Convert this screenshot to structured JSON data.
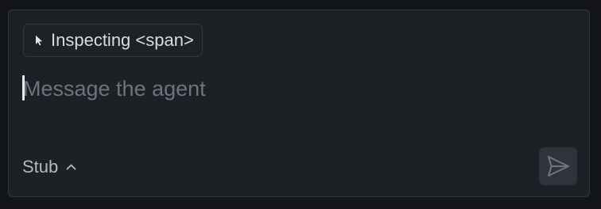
{
  "composer": {
    "context_chip": {
      "label": "Inspecting <span>",
      "icon": "cursor-pointer-icon"
    },
    "input": {
      "value": "",
      "placeholder": "Message the agent"
    },
    "model_selector": {
      "label": "Stub",
      "icon": "chevron-up-icon"
    },
    "send_button": {
      "icon": "send-icon",
      "enabled": false
    }
  },
  "colors": {
    "background": "#131518",
    "panel": "#1d2024",
    "border": "#33373c",
    "text": "#d8dbdf",
    "placeholder": "#6f747b",
    "send_button_bg": "#30343a",
    "send_icon": "#707680"
  }
}
